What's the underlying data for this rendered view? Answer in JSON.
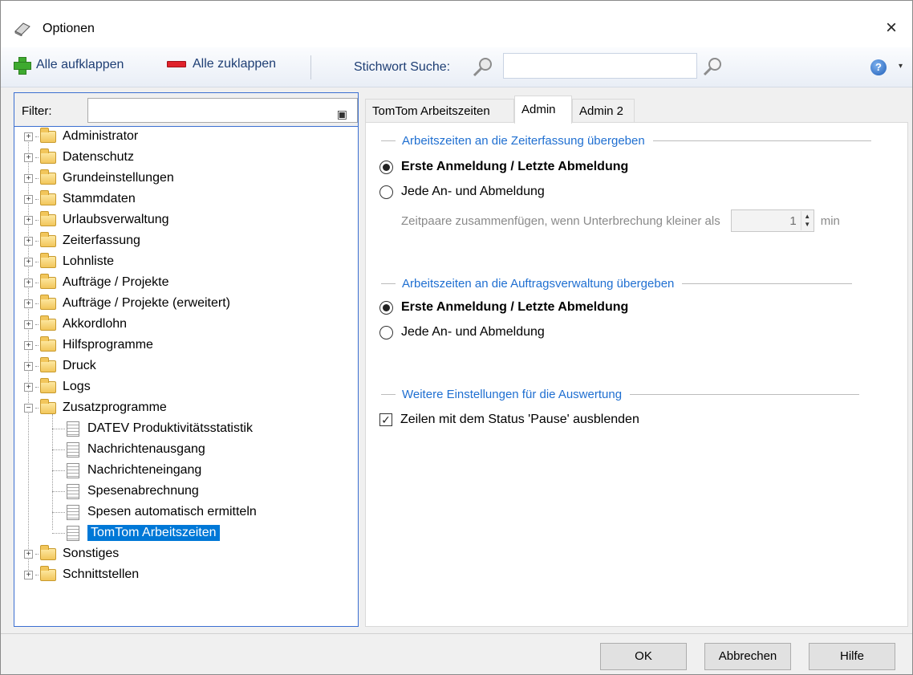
{
  "window": {
    "title": "Optionen",
    "close_symbol": "×"
  },
  "toolbar": {
    "expand_all": "Alle aufklappen",
    "collapse_all": "Alle zuklappen",
    "search_label": "Stichwort Suche:",
    "search_value": "",
    "help_symbol": "?",
    "dropdown_symbol": "▾"
  },
  "filter": {
    "label": "Filter:",
    "value": ""
  },
  "tree": {
    "items": [
      "Administrator",
      "Datenschutz",
      "Grundeinstellungen",
      "Stammdaten",
      "Urlaubsverwaltung",
      "Zeiterfassung",
      "Lohnliste",
      "Aufträge / Projekte",
      "Aufträge / Projekte (erweitert)",
      "Akkordlohn",
      "Hilfsprogramme",
      "Druck",
      "Logs",
      "Zusatzprogramme"
    ],
    "children": [
      "DATEV Produktivitätsstatistik",
      "Nachrichtenausgang",
      "Nachrichteneingang",
      "Spesenabrechnung",
      "Spesen automatisch ermitteln",
      "TomTom Arbeitszeiten"
    ],
    "items_after": [
      "Sonstiges",
      "Schnittstellen"
    ],
    "expander_plus": "+",
    "expander_minus": "−"
  },
  "tabs": [
    "TomTom Arbeitszeiten",
    "Admin",
    "Admin 2"
  ],
  "groups": {
    "zeiterfassung": {
      "title": "Arbeitszeiten an die Zeiterfassung übergeben",
      "option1": "Erste Anmeldung / Letzte Abmeldung",
      "option2": "Jede An- und Abmeldung",
      "pair_label": "Zeitpaare zusammenfügen, wenn Unterbrechung kleiner als",
      "pair_value": "1",
      "pair_unit": "min"
    },
    "auftrag": {
      "title": "Arbeitszeiten an die Auftragsverwaltung übergeben",
      "option1": "Erste Anmeldung / Letzte Abmeldung",
      "option2": "Jede An- und Abmeldung"
    },
    "weitere": {
      "title": "Weitere Einstellungen für die Auswertung",
      "checkbox_label": "Zeilen mit dem Status 'Pause' ausblenden",
      "checkbox_mark": "✓"
    }
  },
  "buttons": {
    "ok": "OK",
    "cancel": "Abbrechen",
    "help": "Hilfe"
  }
}
